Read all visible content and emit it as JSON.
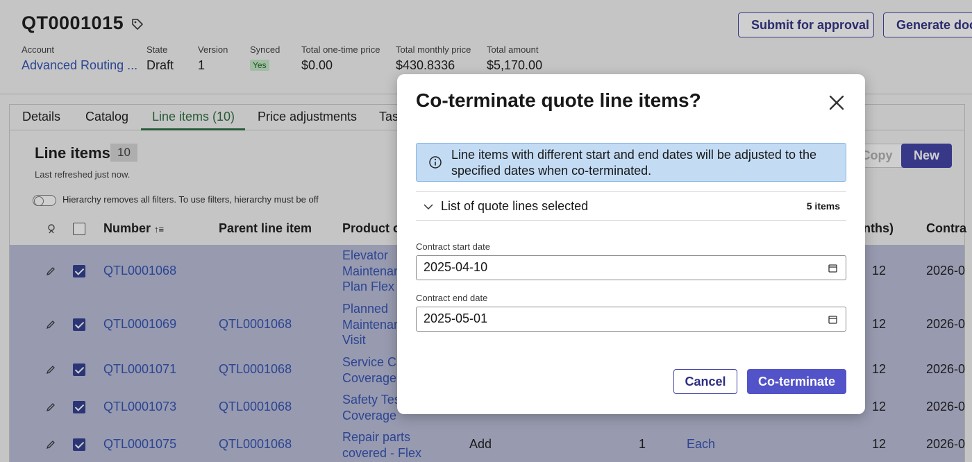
{
  "header": {
    "quote_id": "QT0001015",
    "submit_label": "Submit for approval",
    "generate_label": "Generate doc",
    "fields": {
      "account_label": "Account",
      "account_value": "Advanced Routing ...",
      "state_label": "State",
      "state_value": "Draft",
      "version_label": "Version",
      "version_value": "1",
      "synced_label": "Synced",
      "synced_value": "Yes",
      "onetime_label": "Total one-time price",
      "onetime_value": "$0.00",
      "monthly_label": "Total monthly price",
      "monthly_value": "$430.8336",
      "amount_label": "Total amount",
      "amount_value": "$5,170.00"
    }
  },
  "tabs": [
    "Details",
    "Catalog",
    "Line items (10)",
    "Price adjustments",
    "Tas"
  ],
  "line_items": {
    "title": "Line items",
    "count": "10",
    "refreshed": "Last refreshed just now.",
    "toggle_label": "Hierarchy removes all filters. To use filters, hierarchy must be off",
    "copy_label": "Copy",
    "new_label": "New",
    "columns": {
      "number": "Number",
      "sort_indicator": "↑≡",
      "parent": "Parent line item",
      "product": "Product o",
      "months": "nths)",
      "contract": "Contra"
    },
    "rows": [
      {
        "number": "QTL0001068",
        "parent": "",
        "product": [
          "Elevator",
          "Maintenan",
          "Plan Flex"
        ],
        "action": "",
        "qty": "",
        "unit": "",
        "months": "12",
        "contract": "2026-0"
      },
      {
        "number": "QTL0001069",
        "parent": "QTL0001068",
        "product": [
          "Planned",
          "Maintenan",
          "Visit"
        ],
        "action": "",
        "qty": "",
        "unit": "",
        "months": "12",
        "contract": "2026-0"
      },
      {
        "number": "QTL0001071",
        "parent": "QTL0001068",
        "product": [
          "Service Ca",
          "Coverage"
        ],
        "action": "",
        "qty": "",
        "unit": "",
        "months": "12",
        "contract": "2026-0"
      },
      {
        "number": "QTL0001073",
        "parent": "QTL0001068",
        "product": [
          "Safety Tes",
          "Coverage"
        ],
        "action": "",
        "qty": "",
        "unit": "",
        "months": "12",
        "contract": "2026-0"
      },
      {
        "number": "QTL0001075",
        "parent": "QTL0001068",
        "product": [
          "Repair parts",
          "covered - Flex"
        ],
        "action": "Add",
        "qty": "1",
        "unit": "Each",
        "months": "12",
        "contract": "2026-0"
      }
    ]
  },
  "modal": {
    "title": "Co-terminate quote line items?",
    "banner_text": "Line items with different start and end dates will be adjusted to the specified dates when co-terminated.",
    "accordion_label": "List of quote lines selected",
    "accordion_count": "5 items",
    "start_label": "Contract start date",
    "start_value": "2025-04-10",
    "end_label": "Contract end date",
    "end_value": "2025-05-01",
    "cancel_label": "Cancel",
    "confirm_label": "Co-terminate"
  }
}
